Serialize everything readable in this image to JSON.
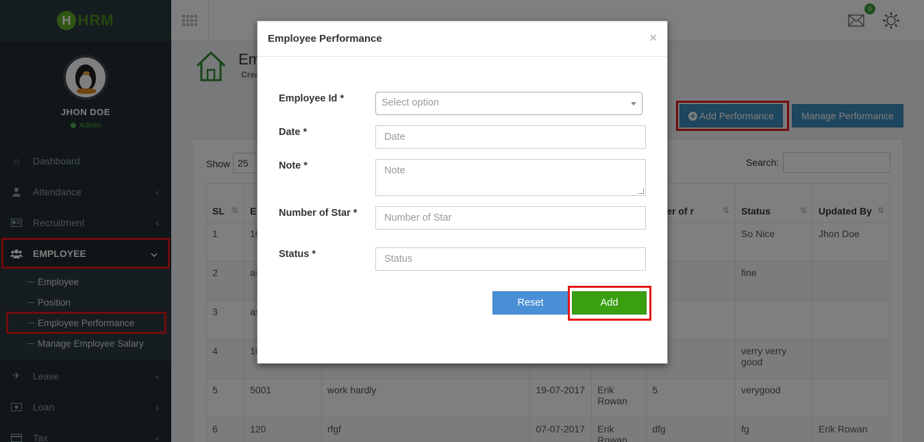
{
  "app": {
    "logo_letter": "H",
    "logo_text": "HRM"
  },
  "profile": {
    "name": "JHON DOE",
    "role": "Admin"
  },
  "sidebar": {
    "items": [
      {
        "label": "Dashboard",
        "icon": "home-icon",
        "chevron": ""
      },
      {
        "label": "Attendance",
        "icon": "user-icon",
        "chevron": "‹"
      },
      {
        "label": "Recruitment",
        "icon": "id-card-icon",
        "chevron": "‹"
      },
      {
        "label": "EMPLOYEE",
        "icon": "users-icon",
        "chevron": "⌄"
      },
      {
        "label": "Leave",
        "icon": "plane-icon",
        "chevron": "‹"
      },
      {
        "label": "Loan",
        "icon": "money-icon",
        "chevron": "‹"
      },
      {
        "label": "Tax",
        "icon": "card-icon",
        "chevron": "‹"
      }
    ],
    "employee_sub": [
      {
        "label": "Employee"
      },
      {
        "label": "Position"
      },
      {
        "label": "Employee Performance"
      },
      {
        "label": "Manage Employee Salary"
      }
    ]
  },
  "topbar": {
    "mail_count": "0"
  },
  "page": {
    "title": "Em",
    "subtitle": "Crea"
  },
  "actions": {
    "add_performance": "Add Performance",
    "manage_performance": "Manage Performance"
  },
  "table_controls": {
    "show_label": "Show",
    "show_value": "25",
    "search_label": "Search:"
  },
  "table": {
    "headers": [
      "SL",
      "Er Id",
      "",
      "",
      "",
      "mber of r",
      "Status",
      "Updated By"
    ],
    "rows": [
      [
        "1",
        "10",
        "",
        "",
        "",
        "",
        "So Nice",
        "Jhon Doe"
      ],
      [
        "2",
        "as",
        "",
        "",
        "",
        "",
        "fine",
        ""
      ],
      [
        "3",
        "as",
        "",
        "",
        "",
        "",
        "",
        ""
      ],
      [
        "4",
        "10",
        "",
        "",
        "",
        "",
        "verry verry good",
        ""
      ],
      [
        "5",
        "5001",
        "work hardly",
        "19-07-2017",
        "Erik Rowan",
        "5",
        "verygood",
        ""
      ],
      [
        "6",
        "120",
        "rfgf",
        "07-07-2017",
        "Erik Rowan",
        "dfg",
        "fg",
        "Erik Rowan"
      ]
    ]
  },
  "modal": {
    "title": "Employee Performance",
    "close": "×",
    "fields": {
      "employee_id": {
        "label": "Employee Id *",
        "placeholder": "Select option"
      },
      "date": {
        "label": "Date *",
        "placeholder": "Date"
      },
      "note": {
        "label": "Note *",
        "placeholder": "Note"
      },
      "star": {
        "label": "Number of Star *",
        "placeholder": "Number of Star"
      },
      "status": {
        "label": "Status *",
        "placeholder": "Status"
      }
    },
    "reset_label": "Reset",
    "add_label": "Add"
  },
  "colors": {
    "sidebar_bg": "#222d32",
    "primary": "#3c8dbc",
    "success": "#3aa012",
    "highlight": "#e31818",
    "brand": "#5fae27"
  }
}
